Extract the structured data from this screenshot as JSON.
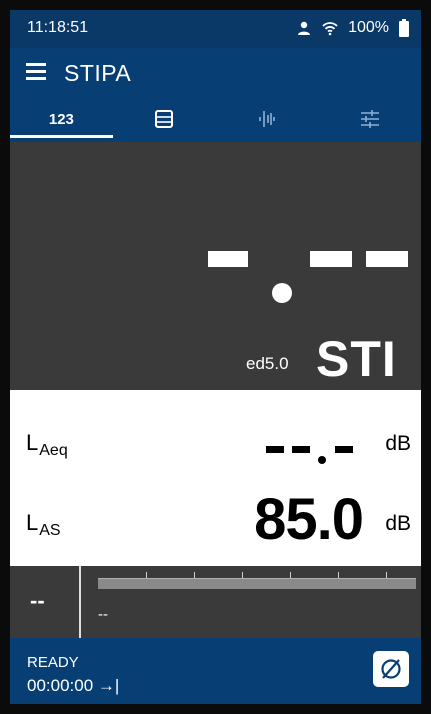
{
  "status_bar": {
    "time": "11:18:51",
    "battery": "100%"
  },
  "app_bar": {
    "title": "STIPA"
  },
  "tabs": [
    {
      "label": "123",
      "icon": "numeric-tab",
      "active": true
    },
    {
      "icon": "list-icon",
      "active": false
    },
    {
      "icon": "spectrum-icon",
      "active": false
    },
    {
      "icon": "settings-sliders-icon",
      "active": false
    }
  ],
  "sti": {
    "value": "-.--",
    "edition": "ed5.0",
    "unit": "STI"
  },
  "levels": {
    "laeq": {
      "label_main": "L",
      "label_sub": "Aeq",
      "value": "--.-",
      "unit": "dB"
    },
    "las": {
      "label_main": "L",
      "label_sub": "AS",
      "value": "85.0",
      "unit": "dB"
    }
  },
  "meter": {
    "left_value": "--",
    "sub_value": "--"
  },
  "bottom": {
    "status": "READY",
    "timer": "00:00:00 →|"
  },
  "colors": {
    "primary": "#073f75",
    "status_bar": "#0a3867",
    "panel_dark": "#3a3a3a"
  }
}
